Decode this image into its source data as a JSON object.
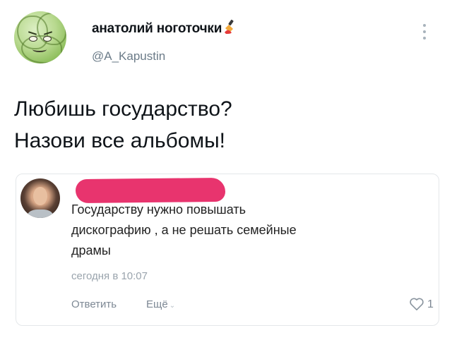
{
  "author": {
    "display_name": "анатолий ноготочки",
    "handle": "@A_Kapustin",
    "avatar_icon": "cabbage-avatar-icon",
    "name_emoji_icon": "nail-polish-emoji-icon"
  },
  "menu_icon": "vertical-dots-icon",
  "tweet": {
    "lines": [
      "Любишь государство?",
      "Назови все альбомы!"
    ]
  },
  "comment": {
    "avatar_icon": "user-avatar-icon",
    "redaction_color": "#e8346e",
    "text_lines": [
      "Государству нужно повышать",
      "дискографию , а не решать семейные",
      "драмы"
    ],
    "time": "сегодня в 10:07",
    "reply_label": "Ответить",
    "more_label": "Ещё",
    "like_icon": "heart-icon",
    "likes": "1"
  }
}
